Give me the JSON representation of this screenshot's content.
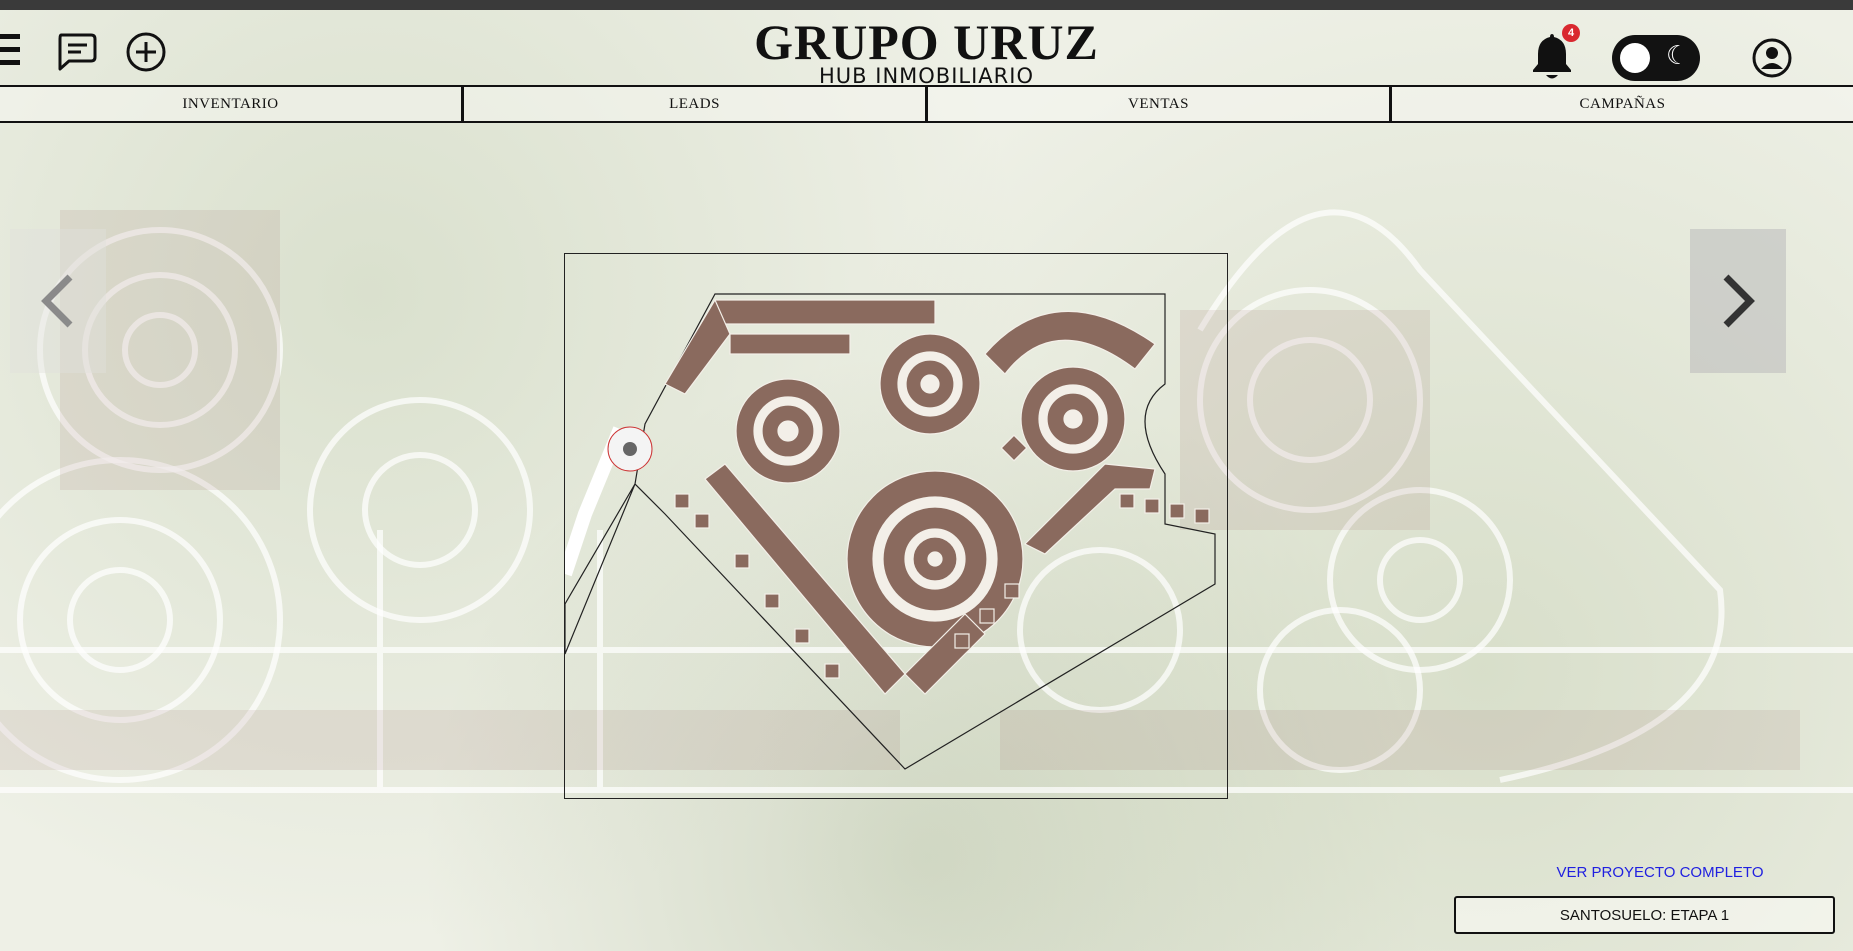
{
  "brand": {
    "title": "GRUPO URUZ",
    "subtitle": "HUB INMOBILIARIO"
  },
  "header": {
    "menu_icon": "hamburger-icon",
    "chat_icon": "chat-icon",
    "add_icon": "plus-circle-icon",
    "notifications": {
      "icon": "bell-icon",
      "count": "4"
    },
    "theme_toggle": {
      "icon": "moon-icon",
      "state": "light"
    },
    "profile_icon": "user-circle-icon"
  },
  "nav": {
    "tabs": [
      {
        "label": "INVENTARIO"
      },
      {
        "label": "LEADS"
      },
      {
        "label": "VENTAS"
      },
      {
        "label": "CAMPAÑAS"
      }
    ]
  },
  "carousel": {
    "prev_icon": "chevron-left-icon",
    "next_icon": "chevron-right-icon"
  },
  "map": {
    "lot_color": "#8a6a5e"
  },
  "footer": {
    "link": "VER PROYECTO COMPLETO",
    "stage": "SANTOSUELO: ETAPA 1"
  },
  "colors": {
    "accent_link": "#2020e0",
    "badge": "#d9282f",
    "toggle_bg": "#121212"
  }
}
